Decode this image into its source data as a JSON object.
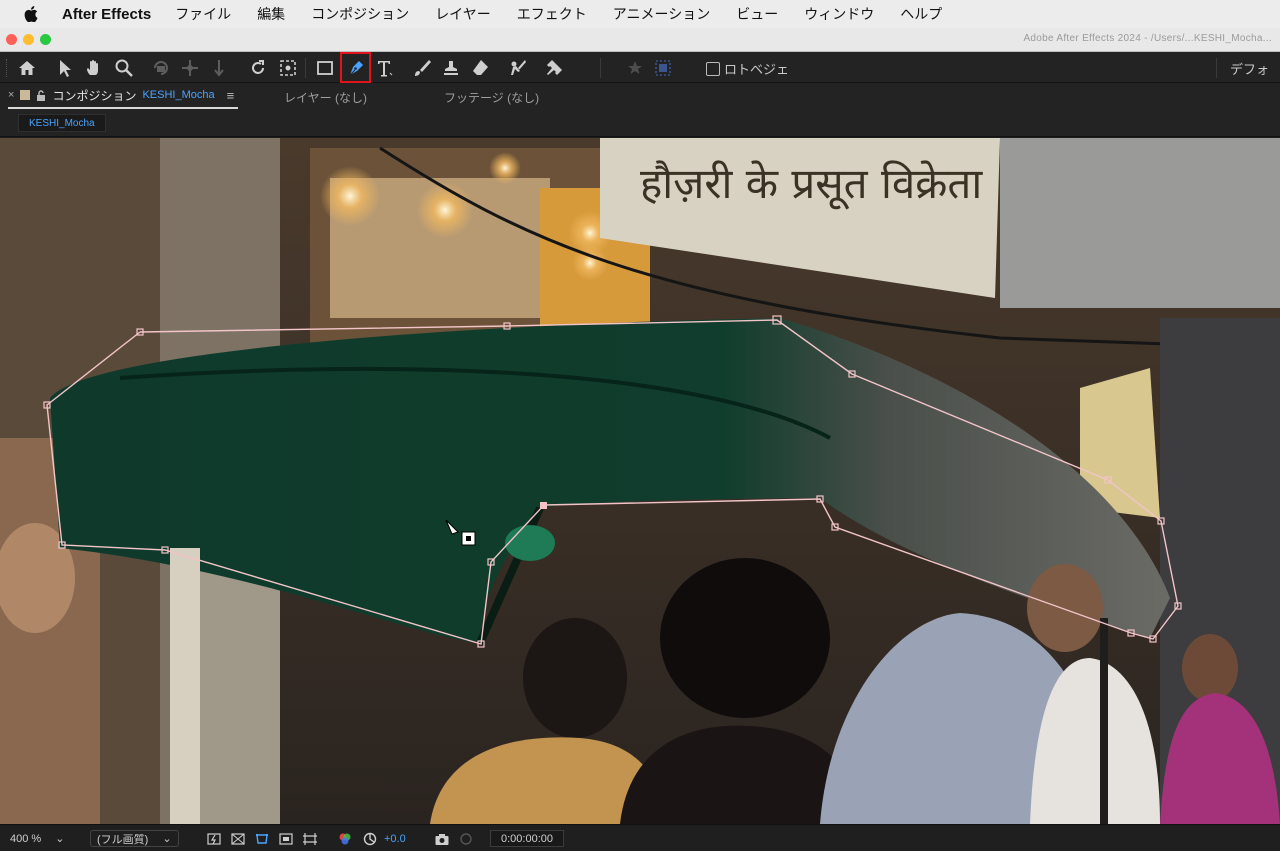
{
  "menubar": {
    "app_name": "After Effects",
    "items": [
      "ファイル",
      "編集",
      "コンポジション",
      "レイヤー",
      "エフェクト",
      "アニメーション",
      "ビュー",
      "ウィンドウ",
      "ヘルプ"
    ]
  },
  "window": {
    "title": "Adobe After Effects 2024 - /Users/...KESHI_Mocha..."
  },
  "toolbar": {
    "tools": [
      "home-icon",
      "selection-tool-icon",
      "hand-tool-icon",
      "zoom-tool-icon",
      "orbit-camera-icon",
      "pan-camera-icon",
      "dolly-camera-icon",
      "rotation-tool-icon",
      "pan-behind-icon",
      "rectangle-tool-icon",
      "pen-tool-icon",
      "type-tool-icon",
      "brush-tool-icon",
      "clone-stamp-icon",
      "eraser-icon",
      "roto-brush-icon",
      "puppet-pin-icon"
    ],
    "active_tool": "pen-tool-icon",
    "active_highlight_color": "#e1141b",
    "roto_bezier_label": "ロトベジェ",
    "workspace_label": "デフォ"
  },
  "panel": {
    "comp_tab_label": "コンポジション",
    "comp_name": "KESHI_Mocha",
    "layer_tab_label": "レイヤー (なし)",
    "footage_tab_label": "フッテージ (なし)",
    "breadcrumb": "KESHI_Mocha"
  },
  "viewer": {
    "sign_text": "हौज़री के प्रसूत विक्रेता"
  },
  "bottombar": {
    "zoom": "400 %",
    "resolution": "(フル画質)",
    "exposure": "+0.0",
    "timecode": "0:00:00:00"
  },
  "colors": {
    "accent_blue": "#4aa3ff",
    "mask_path": "#f2c4c8"
  }
}
